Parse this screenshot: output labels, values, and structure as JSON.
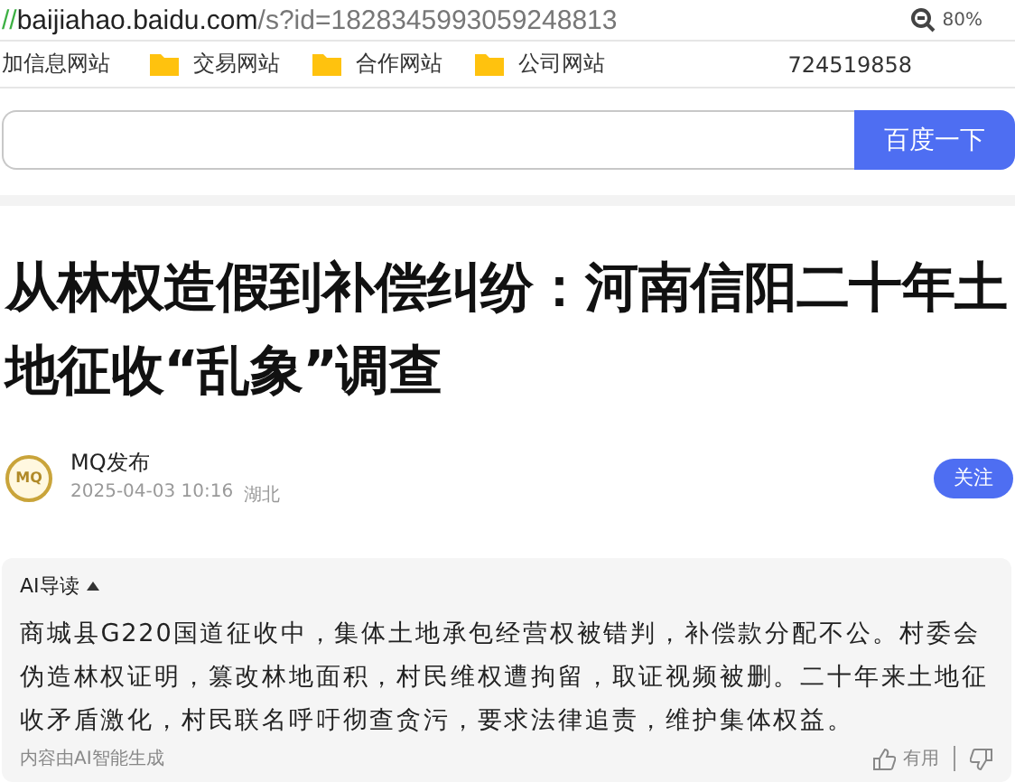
{
  "address_bar": {
    "scheme": "//",
    "host": "baijiahao.baidu.com",
    "path": "/s?id=1828345993059248813",
    "zoom": "80%"
  },
  "bookmarks": [
    {
      "label": "加信息网站",
      "folder": false
    },
    {
      "label": "交易网站",
      "folder": true
    },
    {
      "label": "合作网站",
      "folder": true
    },
    {
      "label": "公司网站",
      "folder": true
    }
  ],
  "bookmark_note": "724519858",
  "search": {
    "button": "百度一下"
  },
  "article": {
    "title": "从林权造假到补偿纠纷：河南信阳二十年土地征收“乱象”调查",
    "author": "MQ发布",
    "avatar": "MQ",
    "date": "2025-04-03 10:16",
    "location": "湖北",
    "follow": "关注"
  },
  "ai_summary": {
    "heading": "AI导读",
    "expanded": true,
    "text": "商城县G220国道征收中，集体土地承包经营权被错判，补偿款分配不公。村委会伪造林权证明，篡改林地面积，村民维权遭拘留，取证视频被删。二十年来土地征收矛盾激化，村民联名呼吁彻查贪污，要求法律追责，维护集体权益。",
    "footer": "内容由AI智能生成",
    "useful": "有用"
  }
}
